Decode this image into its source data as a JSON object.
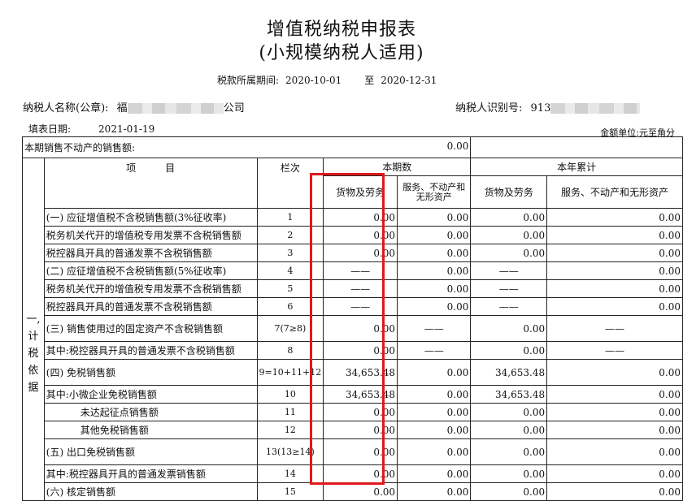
{
  "header": {
    "title_line1": "增值税纳税申报表",
    "title_line2": "(小规模纳税人适用)",
    "period_label": "税款所属期间:",
    "period_start": "2020-10-01",
    "period_to": "至",
    "period_end": "2020-12-31",
    "taxpayer_name_label": "纳税人名称(公章):",
    "taxpayer_name_start": "福",
    "taxpayer_name_end": "公司",
    "taxpayer_id_label": "纳税人识别号:",
    "taxpayer_id_prefix": "913",
    "fill_date_label": "填表日期:",
    "fill_date": "2021-01-19",
    "unit": "金额单位:元至角分"
  },
  "table": {
    "realestate_label": "本期销售不动产的销售额:",
    "realestate_value": "0.00",
    "col_item": "项　　　目",
    "col_line": "栏次",
    "col_current": "本期数",
    "col_ytd": "本年累计",
    "col_goods": "货物及劳务",
    "col_services": "服务、不动产和无形资产",
    "col_services_ytd": "服务、不动产和无形资产",
    "side_label": [
      "一,",
      "计",
      "税",
      "依",
      "据"
    ],
    "rows": [
      {
        "item": "(一) 应征增值税不含税销售额(3%征收率)",
        "line": "1",
        "g": "0.00",
        "s": "0.00",
        "gy": "0.00",
        "sy": "0.00"
      },
      {
        "item": "税务机关代开的增值税专用发票不含税销售额",
        "line": "2",
        "g": "0.00",
        "s": "0.00",
        "gy": "0.00",
        "sy": "0.00"
      },
      {
        "item": "税控器具开具的普通发票不含税销售额",
        "line": "3",
        "g": "0.00",
        "s": "0.00",
        "gy": "0.00",
        "sy": "0.00"
      },
      {
        "item": "(二) 应征增值税不含税销售额(5%征收率)",
        "line": "4",
        "g": "——",
        "s": "0.00",
        "gy": "——",
        "sy": "0.00"
      },
      {
        "item": "税务机关代开的增值税专用发票不含税销售额",
        "line": "5",
        "g": "——",
        "s": "0.00",
        "gy": "——",
        "sy": "0.00"
      },
      {
        "item": "税控器具开具的普通发票不含税销售额",
        "line": "6",
        "g": "——",
        "s": "0.00",
        "gy": "——",
        "sy": "0.00"
      },
      {
        "item": "(三) 销售使用过的固定资产不含税销售额",
        "line": "7(7≥8)",
        "g": "0.00",
        "s": "——",
        "gy": "0.00",
        "sy": "——"
      },
      {
        "item": "其中:税控器具开具的普通发票不含税销售额",
        "line": "8",
        "g": "0.00",
        "s": "——",
        "gy": "0.00",
        "sy": "——"
      },
      {
        "item": "(四) 免税销售额",
        "line": "9=10+11+12",
        "g": "34,653.48",
        "s": "0.00",
        "gy": "34,653.48",
        "sy": "0.00"
      },
      {
        "item": "其中:小微企业免税销售额",
        "line": "10",
        "g": "34,653.48",
        "s": "0.00",
        "gy": "34,653.48",
        "sy": "0.00"
      },
      {
        "item": "未达起征点销售额",
        "line": "11",
        "g": "0.00",
        "s": "0.00",
        "gy": "0.00",
        "sy": "0.00"
      },
      {
        "item": "其他免税销售额",
        "line": "12",
        "g": "0.00",
        "s": "0.00",
        "gy": "0.00",
        "sy": "0.00"
      },
      {
        "item": "(五) 出口免税销售额",
        "line": "13(13≥14)",
        "g": "0.00",
        "s": "0.00",
        "gy": "0.00",
        "sy": "0.00"
      },
      {
        "item": "其中:税控器具开具的普通发票销售额",
        "line": "14",
        "g": "0.00",
        "s": "0.00",
        "gy": "0.00",
        "sy": "0.00"
      },
      {
        "item": "(六) 核定销售额",
        "line": "15",
        "g": "0.00",
        "s": "0.00",
        "gy": "0.00",
        "sy": "0.00"
      }
    ]
  },
  "colors": {
    "highlight": "#e0191c",
    "border": "#222222"
  }
}
